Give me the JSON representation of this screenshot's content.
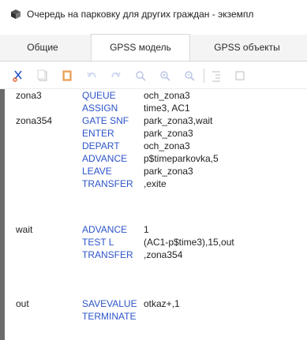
{
  "window": {
    "title": "Очередь на парковку для других граждан  - экземпл",
    "colors": {
      "accent": "#2c54c9",
      "text": "#222222"
    }
  },
  "tabs": [
    {
      "label": "Общие",
      "active": false
    },
    {
      "label": "GPSS модель",
      "active": true
    },
    {
      "label": "GPSS объекты",
      "active": false
    }
  ],
  "toolbar": {
    "buttons": [
      "cut-icon",
      "copy-icon",
      "paste-icon",
      "undo-icon",
      "redo-icon",
      "zoom-icon",
      "zoom-in-icon",
      "zoom-out-icon",
      "indent-icon",
      "outdent-icon"
    ]
  },
  "code": {
    "lines": [
      {
        "label": "zona3",
        "op": "QUEUE",
        "args": "och_zona3"
      },
      {
        "label": "",
        "op": "ASSIGN",
        "args": "time3, AC1"
      },
      {
        "label": "zona354",
        "op": "GATE SNF",
        "args": "park_zona3,wait"
      },
      {
        "label": "",
        "op": "ENTER",
        "args": "park_zona3"
      },
      {
        "label": "",
        "op": "DEPART",
        "args": "och_zona3"
      },
      {
        "label": "",
        "op": "ADVANCE",
        "args": "p$timeparkovka,5"
      },
      {
        "label": "",
        "op": "LEAVE",
        "args": "park_zona3"
      },
      {
        "label": "",
        "op": "TRANSFER",
        "args": ",exite"
      },
      {
        "label": "wait",
        "op": "ADVANCE",
        "args": "1"
      },
      {
        "label": "",
        "op": "TEST L",
        "args": "(AC1-p$time3),15,out"
      },
      {
        "label": "",
        "op": "TRANSFER",
        "args": ",zona354"
      },
      {
        "label": "out",
        "op": "SAVEVALUE",
        "args": "otkaz+,1"
      },
      {
        "label": "",
        "op": "TERMINATE",
        "args": ""
      }
    ]
  }
}
